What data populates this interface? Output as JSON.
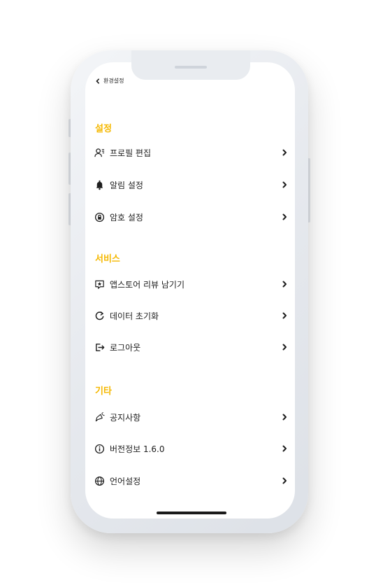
{
  "header": {
    "back_label": "환경설정"
  },
  "sections": [
    {
      "title": "설정",
      "items": [
        {
          "label": "프로필 편집",
          "icon": "profile-edit-icon"
        },
        {
          "label": "알림 설정",
          "icon": "bell-icon"
        },
        {
          "label": "암호 설정",
          "icon": "lock-icon"
        }
      ]
    },
    {
      "title": "서비스",
      "items": [
        {
          "label": "앱스토어 리뷰 남기기",
          "icon": "review-star-icon"
        },
        {
          "label": "데이터 초기화",
          "icon": "reset-icon"
        },
        {
          "label": "로그아웃",
          "icon": "logout-icon"
        }
      ]
    },
    {
      "title": "기타",
      "items": [
        {
          "label": "공지사항",
          "icon": "megaphone-icon"
        },
        {
          "label": "버전정보 1.6.0",
          "icon": "info-icon"
        },
        {
          "label": "언어설정",
          "icon": "globe-icon"
        }
      ]
    }
  ],
  "colors": {
    "accent": "#f5b800",
    "text": "#1e1e1e",
    "background": "#ffffff"
  }
}
